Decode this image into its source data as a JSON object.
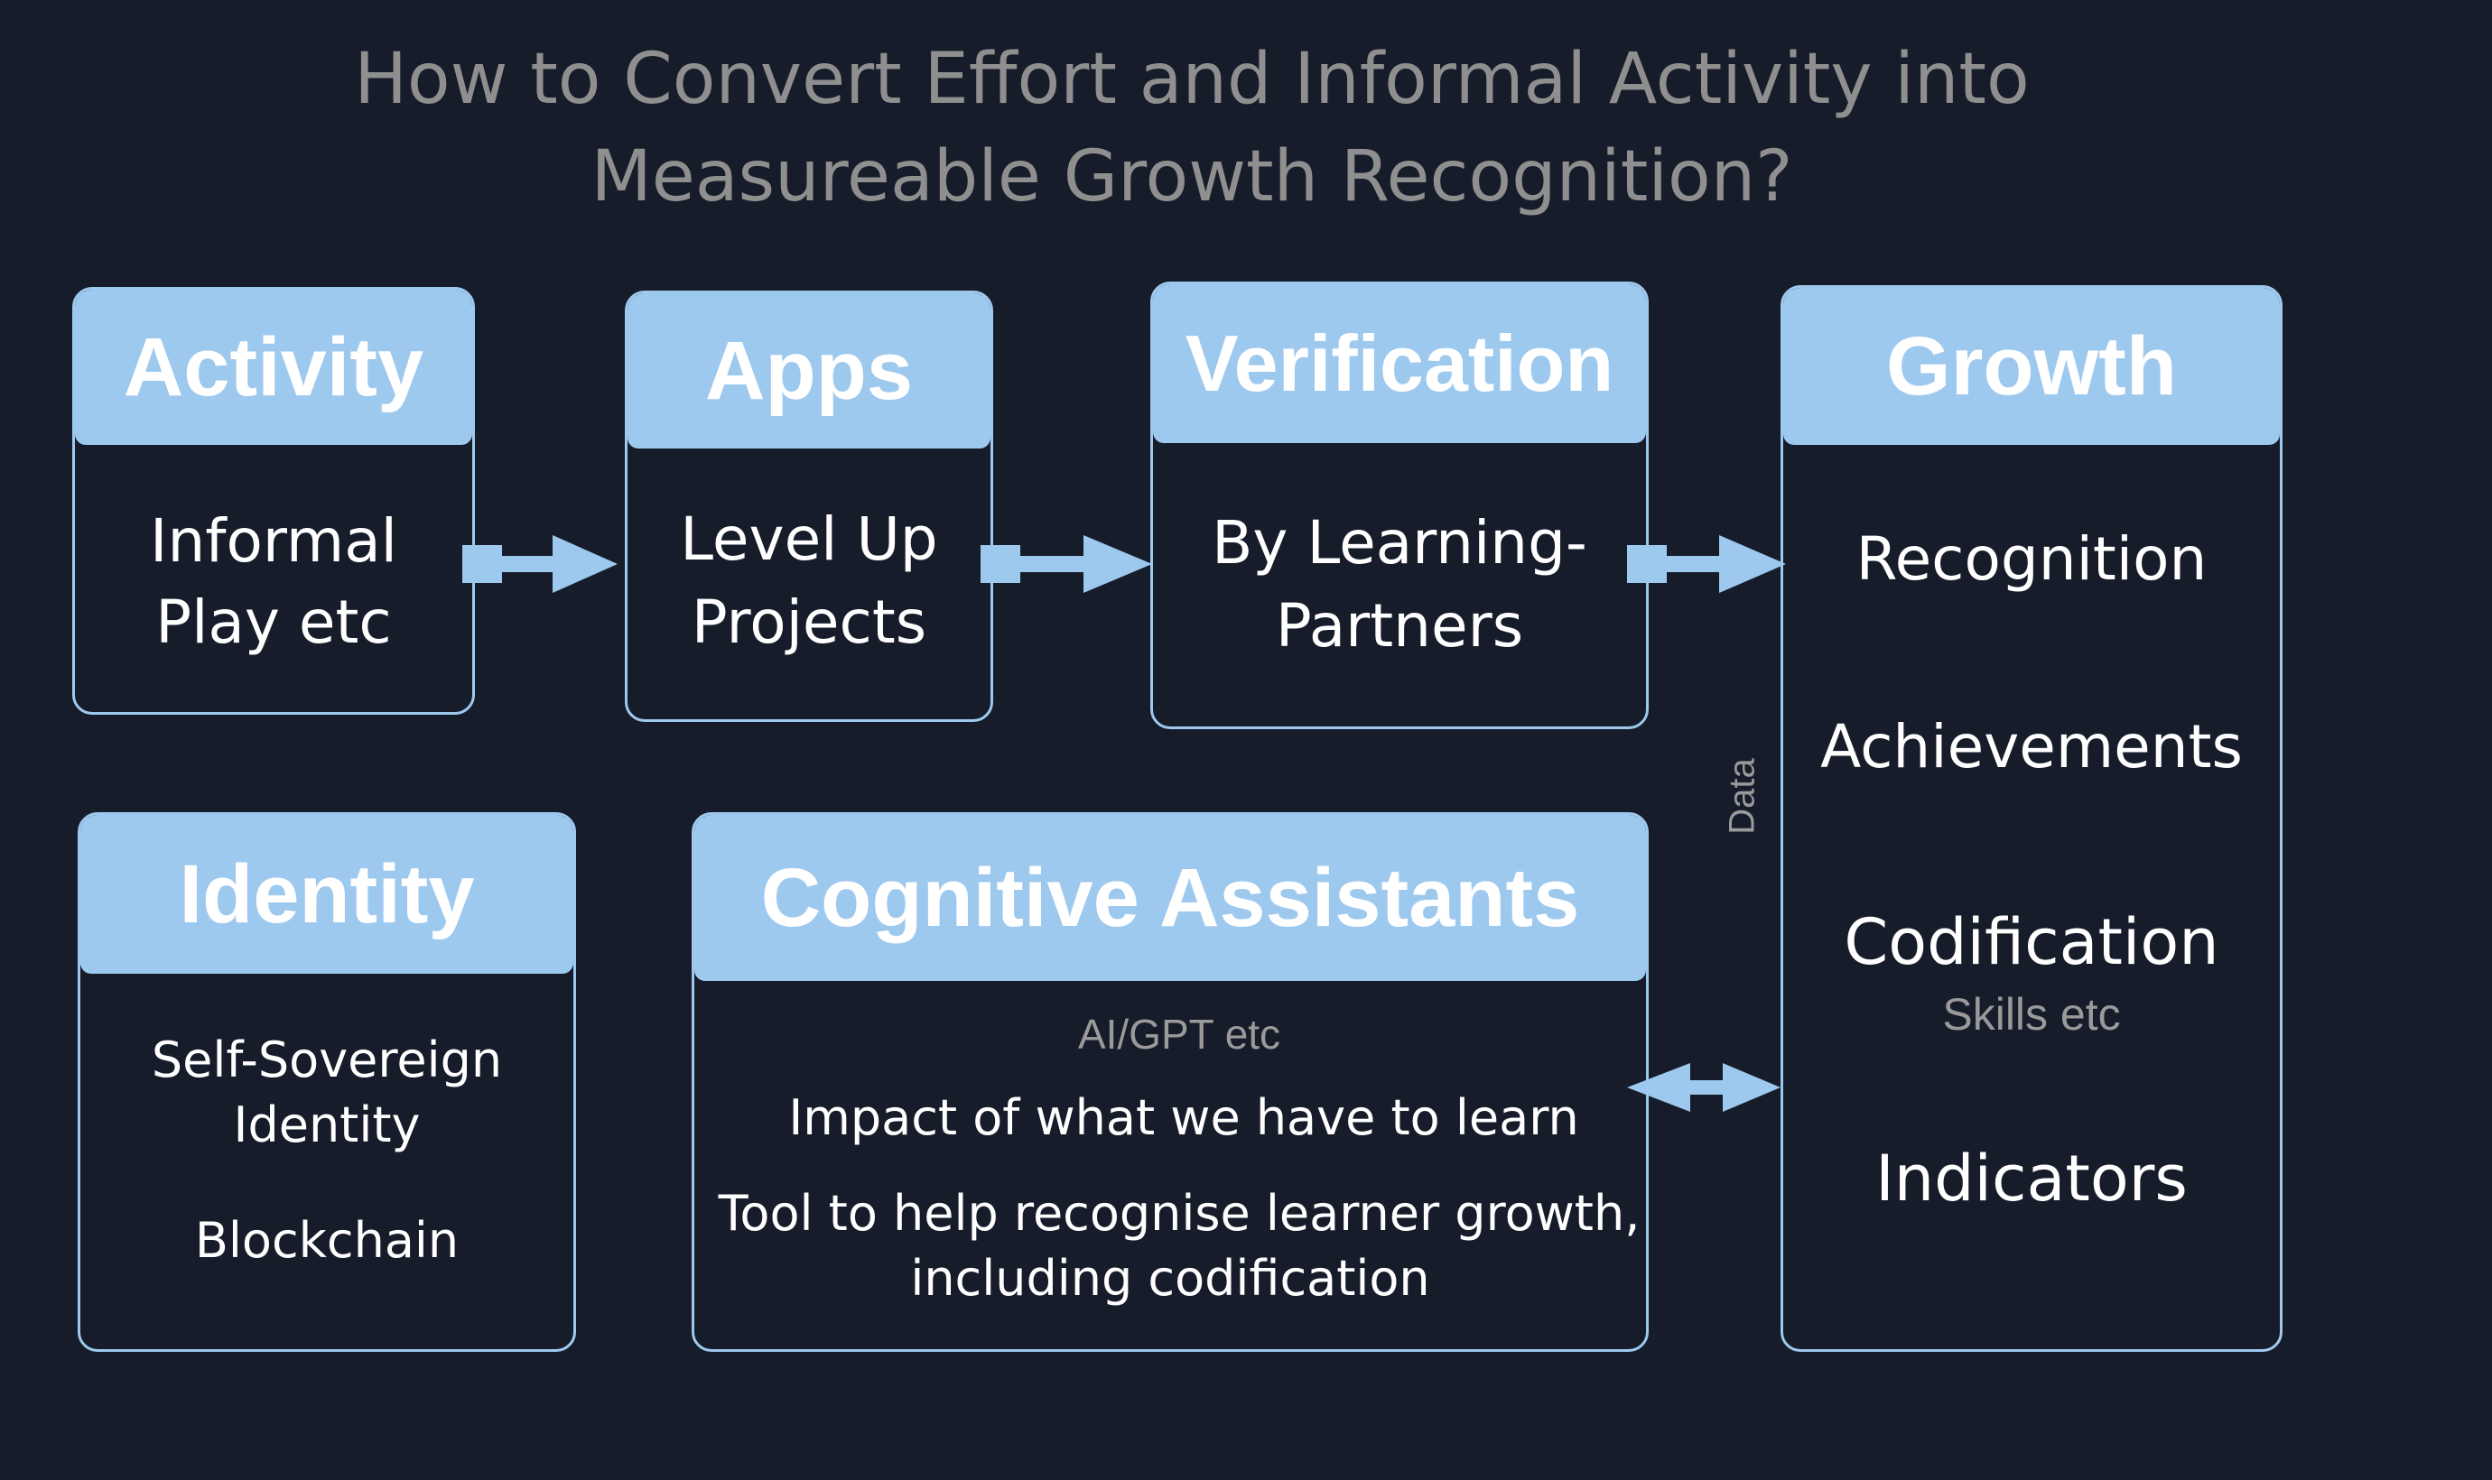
{
  "title": {
    "line1": "How to Convert Effort and Informal Activity into",
    "line2": "Measureable Growth Recognition?"
  },
  "boxes": {
    "activity": {
      "heading": "Activity",
      "line1": "Informal",
      "line2": "Play etc"
    },
    "apps": {
      "heading": "Apps",
      "line1": "Level Up",
      "line2": "Projects"
    },
    "verification": {
      "heading": "Verification",
      "line1": "By Learning-",
      "line2": "Partners"
    },
    "growth": {
      "heading": "Growth",
      "item1": "Recognition",
      "item2": "Achievements",
      "item3": "Codification",
      "item3_sub": "Skills etc",
      "item4": "Indicators"
    },
    "identity": {
      "heading": "Identity",
      "line1": "Self-Sovereign",
      "line2": "Identity",
      "line3": "Blockchain"
    },
    "cognitive": {
      "heading": "Cognitive Assistants",
      "sub": "AI/GPT etc",
      "line1": "Impact of what we have to learn",
      "line2": "Tool to help recognise learner growth,",
      "line3": "including codification"
    }
  },
  "connector_label": "Data",
  "colors": {
    "background": "#161c2a",
    "accent": "#9ec9ee",
    "text": "#ffffff",
    "muted": "#9a9a9a"
  }
}
